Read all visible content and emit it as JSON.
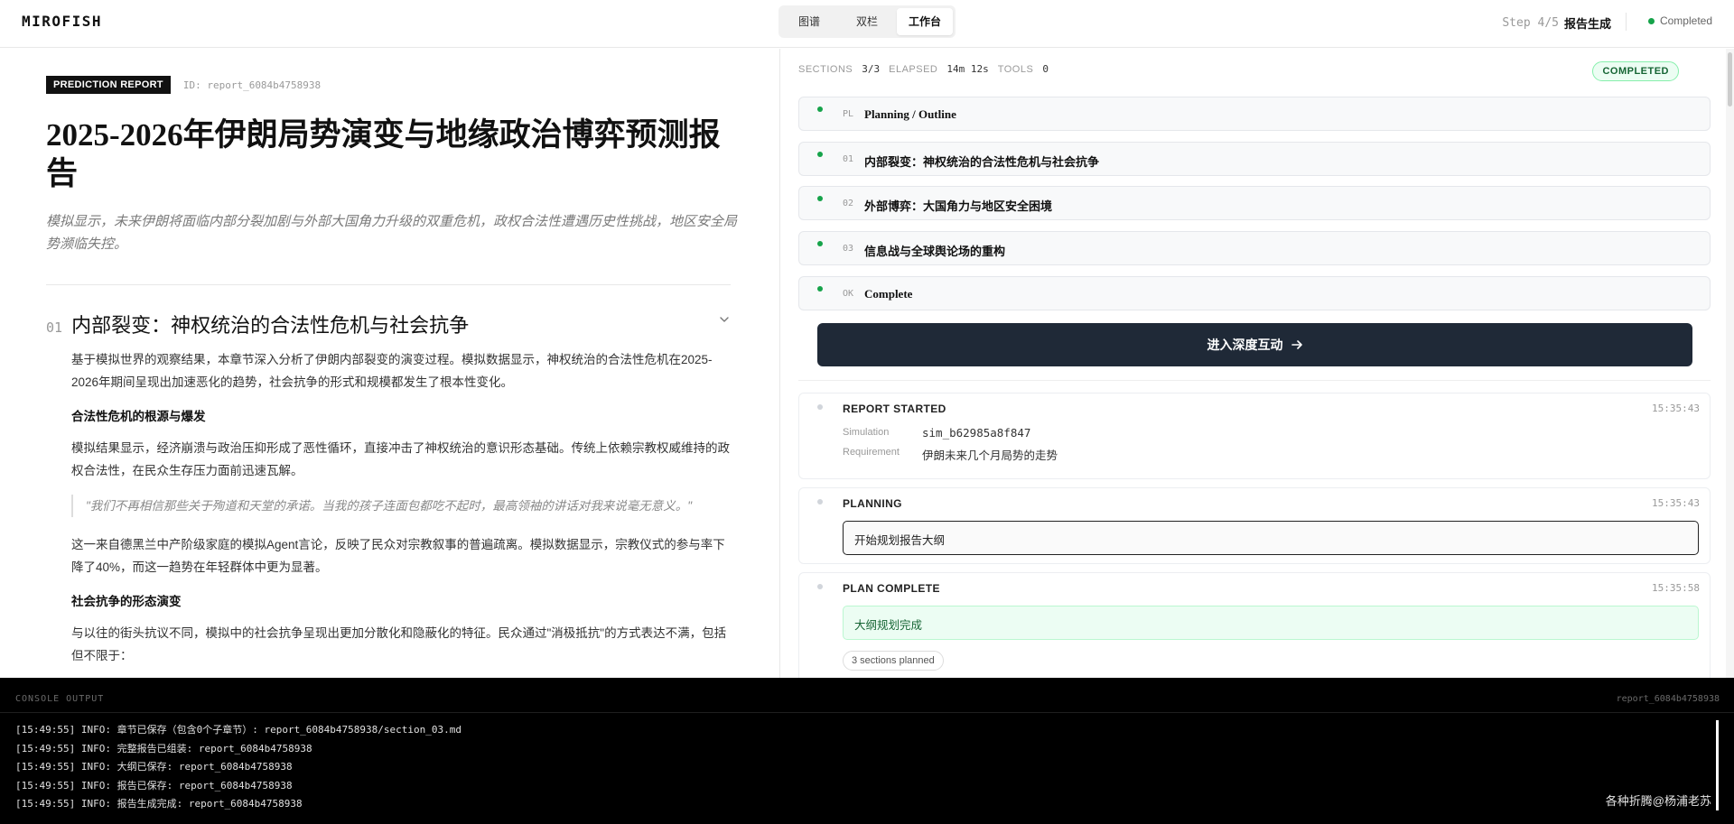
{
  "header": {
    "brand": "MIROFISH",
    "tabs": [
      {
        "label": "图谱",
        "active": false
      },
      {
        "label": "双栏",
        "active": false
      },
      {
        "label": "工作台",
        "active": true
      }
    ],
    "step_counter": "Step 4/5",
    "step_name": "报告生成",
    "status": "Completed"
  },
  "report": {
    "badge": "PREDICTION REPORT",
    "id_label": "ID: report_6084b4758938",
    "title": "2025-2026年伊朗局势演变与地缘政治博弈预测报告",
    "summary": "模拟显示，未来伊朗将面临内部分裂加剧与外部大国角力升级的双重危机，政权合法性遭遇历史性挑战，地区安全局势濒临失控。",
    "section": {
      "number": "01",
      "title": "内部裂变：神权统治的合法性危机与社会抗争",
      "intro": "基于模拟世界的观察结果，本章节深入分析了伊朗内部裂变的演变过程。模拟数据显示，神权统治的合法性危机在2025-2026年期间呈现出加速恶化的趋势，社会抗争的形式和规模都发生了根本性变化。",
      "h1": "合法性危机的根源与爆发",
      "p1": "模拟结果显示，经济崩溃与政治压抑形成了恶性循环，直接冲击了神权统治的意识形态基础。传统上依赖宗教权威维持的政权合法性，在民众生存压力面前迅速瓦解。",
      "quote": "\"我们不再相信那些关于殉道和天堂的承诺。当我的孩子连面包都吃不起时，最高领袖的讲话对我来说毫无意义。\"",
      "p2": "这一来自德黑兰中产阶级家庭的模拟Agent言论，反映了民众对宗教叙事的普遍疏离。模拟数据显示，宗教仪式的参与率下降了40%，而这一趋势在年轻群体中更为显著。",
      "h2": "社会抗争的形态演变",
      "p3": "与以往的街头抗议不同，模拟中的社会抗争呈现出更加分散化和隐蔽化的特征。民众通过\"消极抵抗\"的方式表达不满，包括但不限于："
    }
  },
  "workflow": {
    "metrics": {
      "sections_label": "SECTIONS",
      "sections_value": "3/3",
      "elapsed_label": "ELAPSED",
      "elapsed_value": "14m 12s",
      "tools_label": "TOOLS",
      "tools_value": "0"
    },
    "status_pill": "COMPLETED",
    "sections": [
      {
        "code": "PL",
        "label": "Planning / Outline"
      },
      {
        "code": "01",
        "label": "内部裂变：神权统治的合法性危机与社会抗争"
      },
      {
        "code": "02",
        "label": "外部博弈：大国角力与地区安全困境"
      },
      {
        "code": "03",
        "label": "信息战与全球舆论场的重构"
      },
      {
        "code": "OK",
        "label": "Complete"
      }
    ],
    "cta_label": "进入深度互动",
    "log": {
      "started": {
        "title": "REPORT STARTED",
        "time": "15:35:43",
        "simulation_key": "Simulation",
        "simulation_val": "sim_b62985a8f847",
        "requirement_key": "Requirement",
        "requirement_val": "伊朗未来几个月局势的走势"
      },
      "planning": {
        "title": "PLANNING",
        "time": "15:35:43",
        "message": "开始规划报告大纲"
      },
      "plan_complete": {
        "title": "PLAN COMPLETE",
        "time": "15:35:58",
        "message": "大纲规划完成",
        "chip": "3 sections planned"
      }
    }
  },
  "console": {
    "title": "CONSOLE OUTPUT",
    "ref": "report_6084b4758938",
    "lines": [
      "[15:49:55] INFO: 章节已保存（包含0个子章节）: report_6084b4758938/section_03.md",
      "[15:49:55] INFO: 完整报告已组装: report_6084b4758938",
      "[15:49:55] INFO: 大纲已保存: report_6084b4758938",
      "[15:49:55] INFO: 报告已保存: report_6084b4758938",
      "[15:49:55] INFO: 报告生成完成: report_6084b4758938"
    ],
    "watermark": "各种折腾@杨浦老苏"
  },
  "colors": {
    "accent_dark": "#1f2937",
    "success": "#16a34a",
    "console_bg": "#000000"
  }
}
